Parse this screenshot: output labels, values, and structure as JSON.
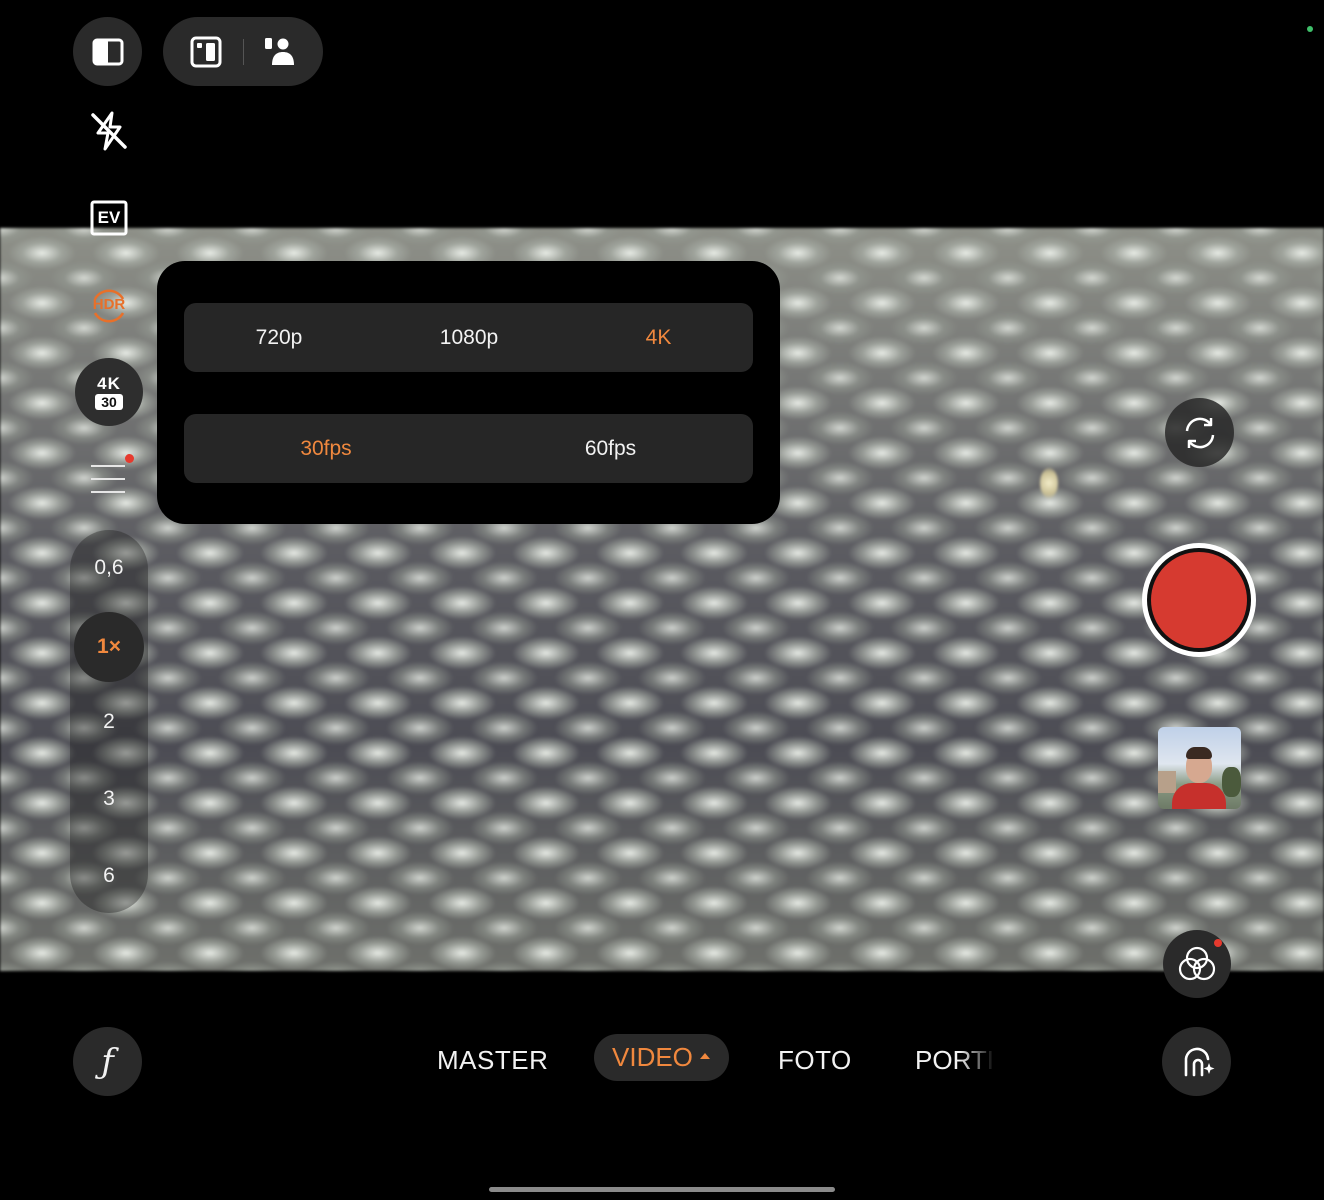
{
  "status": {
    "indicator_color": "#3fc06a"
  },
  "top_bar": {
    "layout_icon": "split-layout-icon",
    "view_icons": [
      "preview-frame-icon",
      "dual-view-person-icon"
    ]
  },
  "side_controls": {
    "flash_icon": "flash-off-icon",
    "ev_label": "EV",
    "hdr_label": "HDR",
    "resolution_badge": {
      "resolution": "4K",
      "fps": "30"
    },
    "menu_icon": "menu-icon"
  },
  "zoom": {
    "levels": [
      "0,6",
      "1×",
      "2",
      "3",
      "6"
    ],
    "active": "1×"
  },
  "popup": {
    "resolutions": [
      "720p",
      "1080p",
      "4K"
    ],
    "selected_resolution": "4K",
    "frame_rates": [
      "30fps",
      "60fps"
    ],
    "selected_frame_rate": "30fps"
  },
  "right_controls": {
    "flip_icon": "switch-camera-icon",
    "shutter_color": "#d63a30",
    "thumbnail": "gallery-thumbnail",
    "filter_icon": "filter-icon"
  },
  "modes": {
    "items": [
      "MASTER",
      "VIDEO",
      "FOTO",
      "PORTI"
    ],
    "active": "VIDEO"
  },
  "bottom": {
    "pro_label": "ƒ",
    "ai_icon": "ai-portrait-icon"
  },
  "colors": {
    "accent": "#f0883e",
    "record": "#d63a30",
    "notification": "#e63a2e"
  }
}
